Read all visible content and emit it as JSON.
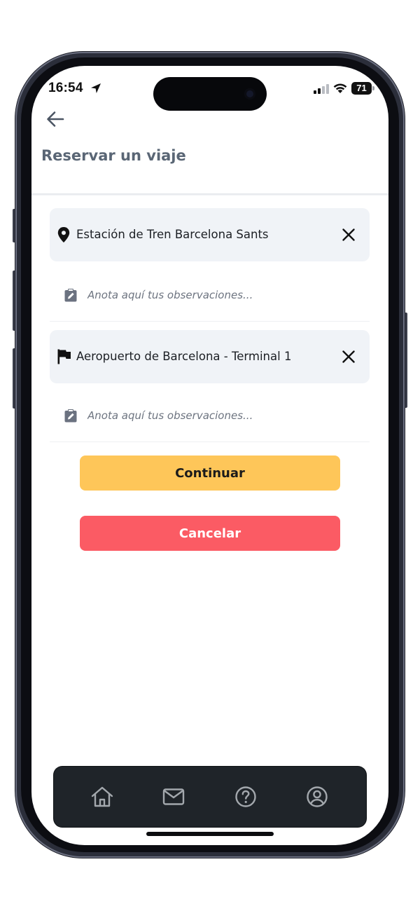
{
  "status_bar": {
    "time": "16:54",
    "battery_level": "71",
    "icons": [
      "location-arrow-icon",
      "cellular-signal-icon",
      "wifi-icon",
      "battery-icon"
    ]
  },
  "header": {
    "back_icon": "arrow-left-icon",
    "title": "Reservar un viaje"
  },
  "trip": {
    "origin": {
      "icon": "map-pin-icon",
      "value": "Estación de Tren Barcelona Sants",
      "clear_icon": "close-icon"
    },
    "origin_notes": {
      "icon": "clipboard-edit-icon",
      "value": "",
      "placeholder": "Anota aquí tus observaciones..."
    },
    "destination": {
      "icon": "flag-icon",
      "value": "Aeropuerto de Barcelona - Terminal 1",
      "clear_icon": "close-icon"
    },
    "destination_notes": {
      "icon": "clipboard-edit-icon",
      "value": "",
      "placeholder": "Anota aquí tus observaciones..."
    }
  },
  "actions": {
    "continue_label": "Continuar",
    "cancel_label": "Cancelar"
  },
  "bottom_nav": {
    "items": [
      {
        "icon": "home-icon"
      },
      {
        "icon": "mail-icon"
      },
      {
        "icon": "help-circle-icon"
      },
      {
        "icon": "user-circle-icon"
      }
    ]
  },
  "colors": {
    "title": "#5a6675",
    "field_background": "#f0f3f7",
    "continue_button": "#fec659",
    "cancel_button": "#fb5b64",
    "nav_background": "#1f2429",
    "nav_icon": "#a3a8ad"
  }
}
